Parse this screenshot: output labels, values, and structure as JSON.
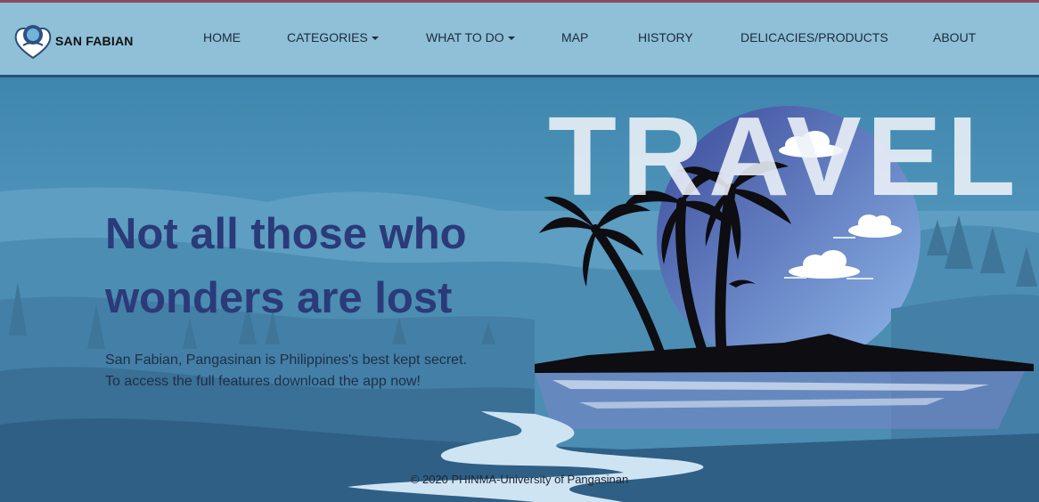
{
  "brand": {
    "name": "SAN FABIAN",
    "logo": "san-fabian-logo"
  },
  "nav": {
    "home": "HOME",
    "categories": "CATEGORIES",
    "what_to_do": "WHAT TO DO",
    "map": "MAP",
    "history": "HISTORY",
    "delicacies": "DELICACIES/PRODUCTS",
    "about": "ABOUT"
  },
  "hero": {
    "headline_line1": "Not all those who",
    "headline_line2": "wonders are lost",
    "subtext_line1": "San Fabian, Pangasinan is Philippines's best kept secret.",
    "subtext_line2": "To access the full features download the app now!",
    "travel_word": "TRAVEL"
  },
  "footer": {
    "copyright": "© 2020 PHINMA-University of Pangasinan"
  },
  "colors": {
    "navbar": "#8fc0d8",
    "sky": "#4f93b8",
    "headline": "#2b3a78",
    "moon": "#4a5aa8"
  }
}
